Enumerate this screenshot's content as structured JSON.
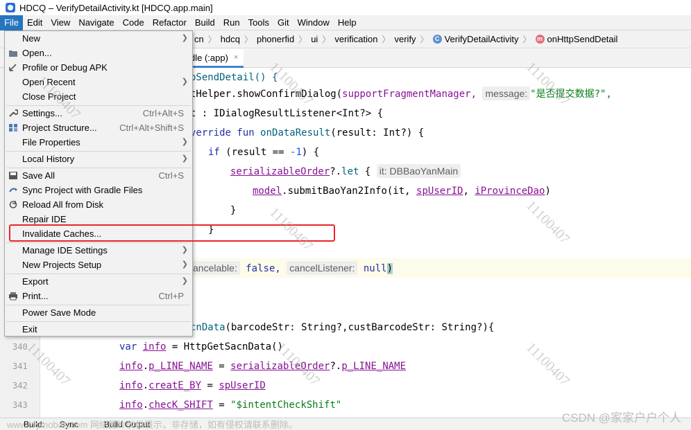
{
  "window": {
    "title": "HDCQ – VerifyDetailActivity.kt [HDCQ.app.main]"
  },
  "menubar": [
    "File",
    "Edit",
    "View",
    "Navigate",
    "Code",
    "Refactor",
    "Build",
    "Run",
    "Tools",
    "Git",
    "Window",
    "Help"
  ],
  "breadcrumb": [
    "cn",
    "hdcq",
    "phonerfid",
    "ui",
    "verification",
    "verify",
    "VerifyDetailActivity",
    "onHttpSendDetail"
  ],
  "tab": {
    "label": "dle (:app)",
    "close": "×"
  },
  "file_menu": {
    "items": [
      {
        "label": "New",
        "shortcut": "",
        "submenu": true
      },
      {
        "label": "Open...",
        "shortcut": "",
        "submenu": false
      },
      {
        "label": "Profile or Debug APK",
        "shortcut": "",
        "submenu": false
      },
      {
        "label": "Open Recent",
        "shortcut": "",
        "submenu": true
      },
      {
        "label": "Close Project",
        "shortcut": "",
        "submenu": false
      },
      {
        "label": "Settings...",
        "shortcut": "Ctrl+Alt+S",
        "submenu": false
      },
      {
        "label": "Project Structure...",
        "shortcut": "Ctrl+Alt+Shift+S",
        "submenu": false
      },
      {
        "label": "File Properties",
        "shortcut": "",
        "submenu": true
      },
      {
        "label": "Local History",
        "shortcut": "",
        "submenu": true
      },
      {
        "label": "Save All",
        "shortcut": "Ctrl+S",
        "submenu": false
      },
      {
        "label": "Sync Project with Gradle Files",
        "shortcut": "",
        "submenu": false
      },
      {
        "label": "Reload All from Disk",
        "shortcut": "",
        "submenu": false
      },
      {
        "label": "Repair IDE",
        "shortcut": "",
        "submenu": false
      },
      {
        "label": "Invalidate Caches...",
        "shortcut": "",
        "submenu": false
      },
      {
        "label": "Manage IDE Settings",
        "shortcut": "",
        "submenu": true
      },
      {
        "label": "New Projects Setup",
        "shortcut": "",
        "submenu": true
      },
      {
        "label": "Export",
        "shortcut": "",
        "submenu": true
      },
      {
        "label": "Print...",
        "shortcut": "Ctrl+P",
        "submenu": false
      },
      {
        "label": "Power Save Mode",
        "shortcut": "",
        "submenu": false
      },
      {
        "label": "Exit",
        "shortcut": "",
        "submenu": false
      }
    ]
  },
  "code": {
    "line1": "pSendDetail() {",
    "line2a": "tHelper.showConfirmDialog(",
    "line2b": "supportFragmentManager,",
    "line2hint": "message:",
    "line2str": "\"是否提交数据?\",",
    "line3": "t : IDialogResultListener<Int?> {",
    "line4a": "verride fun ",
    "line4b": "onDataResult",
    "line4c": "(result: Int?) {",
    "line5a": "if",
    "line5b": " (result == ",
    "line5c": "-1",
    "line5d": ") {",
    "line6a": "serializableOrder",
    "line6b": "?.",
    "line6c": "let",
    "line6d": " {",
    "line6hint": "it: DBBaoYanMain",
    "line7a": "model",
    "line7b": ".submitBaoYan2Info(it, ",
    "line7c": "spUserID",
    "line7d": ", ",
    "line7e": "iProvinceDao",
    "line7f": ")",
    "line8": "}",
    "line9": "}",
    "line10hint1": "ancelable:",
    "line10a": " false,",
    "line10hint2": "cancelListener:",
    "line10b": " null",
    "line10c": ")",
    "line11a": "cnData",
    "line11b": "(barcodeStr: String?,custBarcodeStr: String?){",
    "line12a": "var",
    "line12b": "info",
    "line12c": " = HttpGetSacnData()",
    "line13a": "info",
    "line13b": ".",
    "line13c": "p_LINE_NAME",
    "line13d": " = ",
    "line13e": "serializableOrder",
    "line13f": "?.",
    "line13g": "p_LINE_NAME",
    "line14a": "info",
    "line14b": ".",
    "line14c": "creatE_BY",
    "line14d": " = ",
    "line14e": "spUserID",
    "line15a": "info",
    "line15b": ".",
    "line15c": "checK_SHIFT",
    "line15d": " = ",
    "line15e": "\"$intentCheckShift\"",
    "line_numbers": [
      "340",
      "341",
      "342",
      "343"
    ]
  },
  "statusbar": {
    "build": "Build:",
    "sync": "Sync",
    "build_output": "Build Output"
  },
  "watermarks": {
    "id": "11100407",
    "csdn": "CSDN @家家户户个人",
    "footer": "www.toymoban.com 网络图片仅供展示，非存储，如有侵权请联系删除。"
  },
  "colors": {
    "menu_active": "#2675bf",
    "highlight_box": "#e8262b",
    "keyword": "#1f30a8",
    "field": "#871094",
    "string": "#067d17"
  }
}
